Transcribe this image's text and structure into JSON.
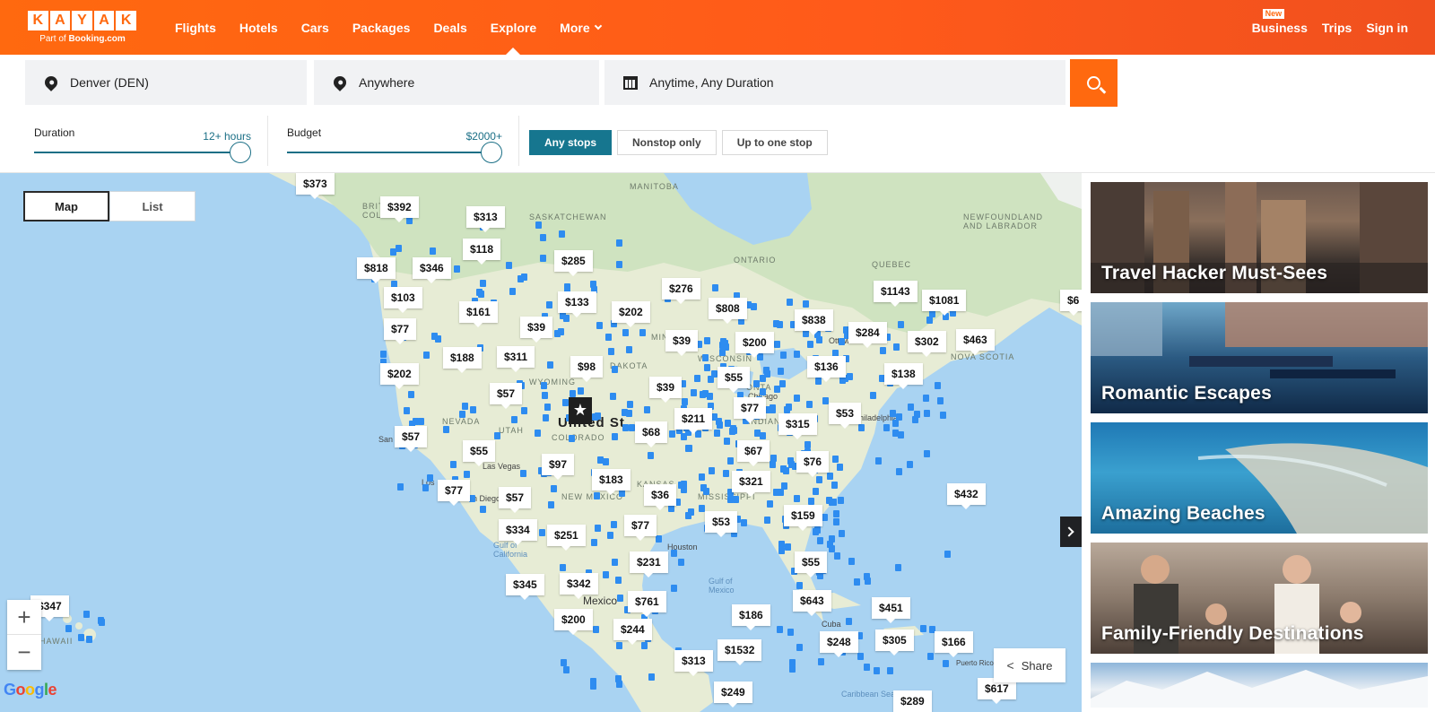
{
  "brand": {
    "logo_letters": [
      "K",
      "A",
      "Y",
      "A",
      "K"
    ],
    "sub_prefix": "Part of",
    "sub_brand": "Booking.com",
    "accent_color": "#ff690f"
  },
  "nav": {
    "items": [
      "Flights",
      "Hotels",
      "Cars",
      "Packages",
      "Deals",
      "Explore",
      "More"
    ],
    "active": "Explore",
    "more_icon": "chevron-down-icon"
  },
  "right_nav": {
    "business": "Business",
    "business_badge": "New",
    "trips": "Trips",
    "sign_in": "Sign in"
  },
  "search": {
    "origin": "Denver (DEN)",
    "destination": "Anywhere",
    "dates": "Anytime, Any Duration",
    "origin_icon": "map-pin-icon",
    "destination_icon": "map-pin-icon",
    "dates_icon": "calendar-icon",
    "button_icon": "search-icon"
  },
  "filters": {
    "duration_label": "Duration",
    "duration_value": "12+ hours",
    "budget_label": "Budget",
    "budget_value": "$2000+",
    "duration_level": 1.0,
    "budget_level": 1.0,
    "stops": [
      "Any stops",
      "Nonstop only",
      "Up to one stop"
    ],
    "selected_stop": "Any stops",
    "stop_color": "#16768f"
  },
  "view_toggle": {
    "map": "Map",
    "list": "List",
    "selected": "Map"
  },
  "map": {
    "labels": {
      "manitoba": "MANITOBA",
      "saskatchewan": "SASKATCHEWAN",
      "british_columbia": "BRITISH COLUMBIA",
      "ontario": "ONTARIO",
      "quebec": "QUEBEC",
      "newfoundland": "NEWFOUNDLAND AND LABRADOR",
      "nova_scotia": "NOVA SCOTIA",
      "ottawa": "Ottawa",
      "philadelphia": "Philadelphia",
      "minnesota": "MINN",
      "wisconsin": "WISCONSIN",
      "north_dakota": "DAKOTA",
      "wyoming": "WYOMING",
      "nevada": "NEVADA",
      "utah": "UTAH",
      "colorado": "COLORADO",
      "indiana": "INDIANA",
      "kansas": "KANSAS",
      "new_mexico": "NEW MEXICO",
      "mississippi": "MISSISSIPPI",
      "san_francisco": "San Fr",
      "las_vegas": "Las Vegas",
      "los_angeles": "Los",
      "san_diego": "San Diego",
      "houston": "Houston",
      "gulf_of_california": "Gulf of California",
      "gulf_of_mexico": "Gulf of Mexico",
      "caribbean": "Caribbean Sea",
      "mexico": "Mexico",
      "cuba": "Cuba",
      "hawaii": "HAWAII",
      "united_states": "United St",
      "onta": "ONTA",
      "chicago": "Chicago",
      "puerto_rico": "Puerto Rico"
    },
    "home_icon": "star-icon",
    "prices": [
      "$373",
      "$392",
      "$313",
      "$118",
      "$285",
      "$818",
      "$346",
      "$103",
      "$161",
      "$133",
      "$202",
      "$276",
      "$808",
      "$838",
      "$1143",
      "$1081",
      "$77",
      "$39",
      "$39",
      "$200",
      "$284",
      "$302",
      "$463",
      "$188",
      "$311",
      "$98",
      "$55",
      "$136",
      "$138",
      "$202",
      "$57",
      "$39",
      "$77",
      "$211",
      "$315",
      "$53",
      "$57",
      "$68",
      "$55",
      "$67",
      "$97",
      "$76",
      "$183",
      "$321",
      "$77",
      "$57",
      "$36",
      "$432",
      "$159",
      "$334",
      "$251",
      "$77",
      "$53",
      "$231",
      "$55",
      "$345",
      "$342",
      "$761",
      "$643",
      "$451",
      "$347",
      "$186",
      "$200",
      "$244",
      "$248",
      "$305",
      "$166",
      "$1532",
      "$313",
      "$249",
      "$289",
      "$617",
      "$6"
    ],
    "zoom_in": "+",
    "zoom_out": "−",
    "google": "Google",
    "share": "Share",
    "share_icon": "share-icon",
    "collapse_icon": "chevron-right-icon"
  },
  "cards": [
    {
      "caption": "Travel Hacker Must-Sees"
    },
    {
      "caption": "Romantic Escapes"
    },
    {
      "caption": "Amazing Beaches"
    },
    {
      "caption": "Family-Friendly Destinations"
    }
  ]
}
